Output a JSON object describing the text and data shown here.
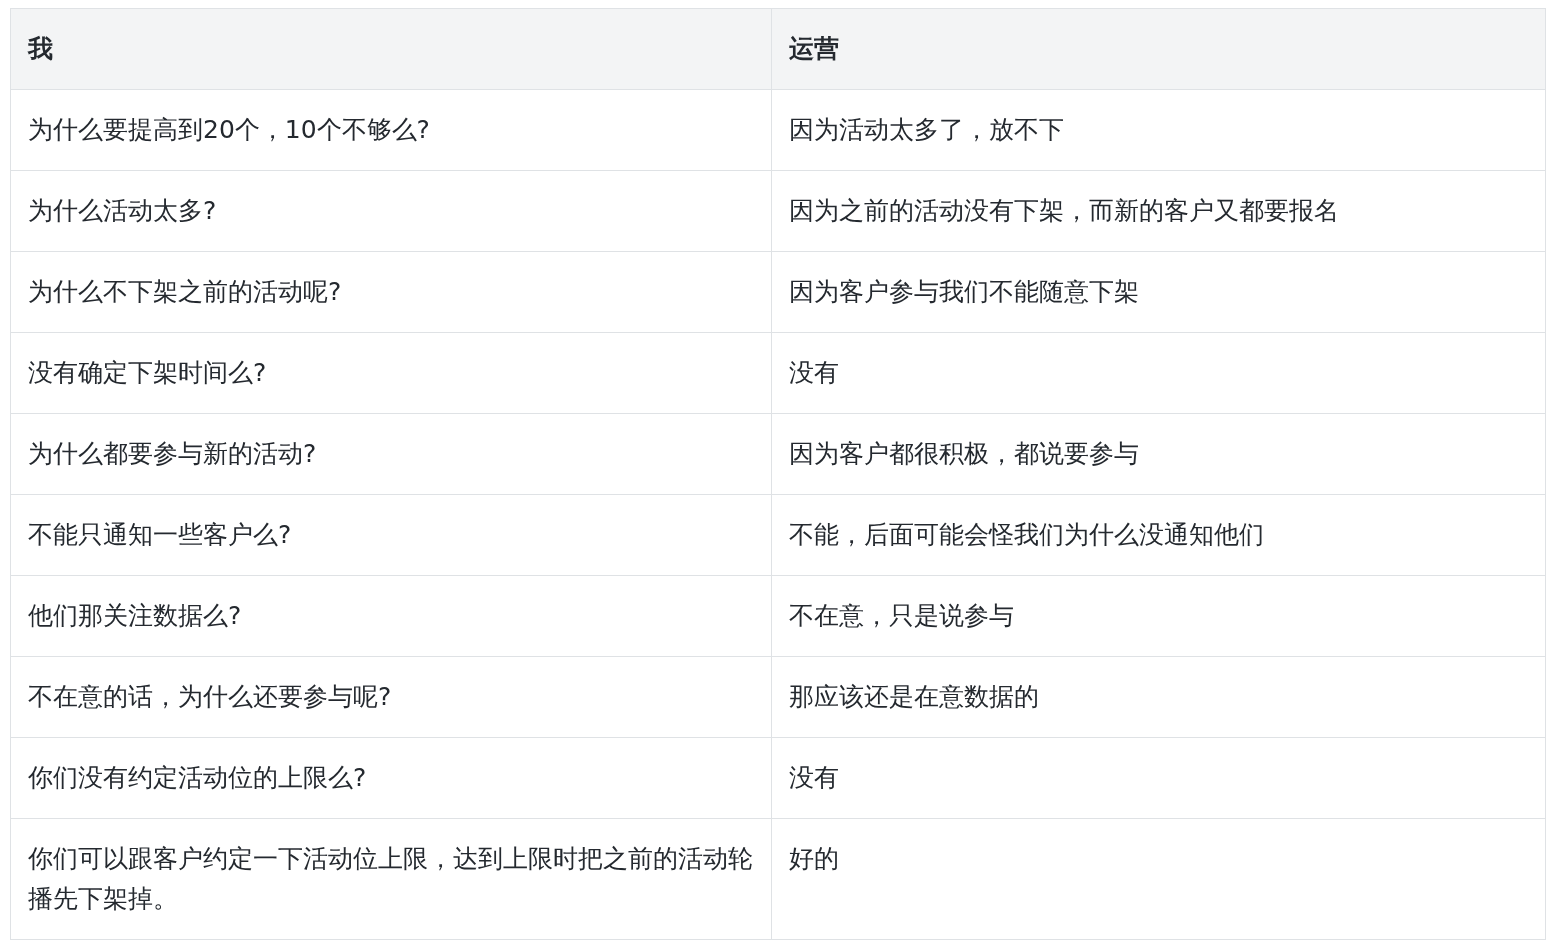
{
  "table": {
    "columns": [
      "我",
      "运营"
    ],
    "rows": [
      [
        "为什么要提高到20个，10个不够么?",
        "因为活动太多了，放不下"
      ],
      [
        "为什么活动太多?",
        "因为之前的活动没有下架，而新的客户又都要报名"
      ],
      [
        "为什么不下架之前的活动呢?",
        "因为客户参与我们不能随意下架"
      ],
      [
        "没有确定下架时间么?",
        "没有"
      ],
      [
        "为什么都要参与新的活动?",
        "因为客户都很积极，都说要参与"
      ],
      [
        "不能只通知一些客户么?",
        "不能，后面可能会怪我们为什么没通知他们"
      ],
      [
        "他们那关注数据么?",
        "不在意，只是说参与"
      ],
      [
        "不在意的话，为什么还要参与呢?",
        "那应该还是在意数据的"
      ],
      [
        "你们没有约定活动位的上限么?",
        "没有"
      ],
      [
        "你们可以跟客户约定一下活动位上限，达到上限时把之前的活动轮播先下架掉。",
        "好的"
      ]
    ]
  }
}
